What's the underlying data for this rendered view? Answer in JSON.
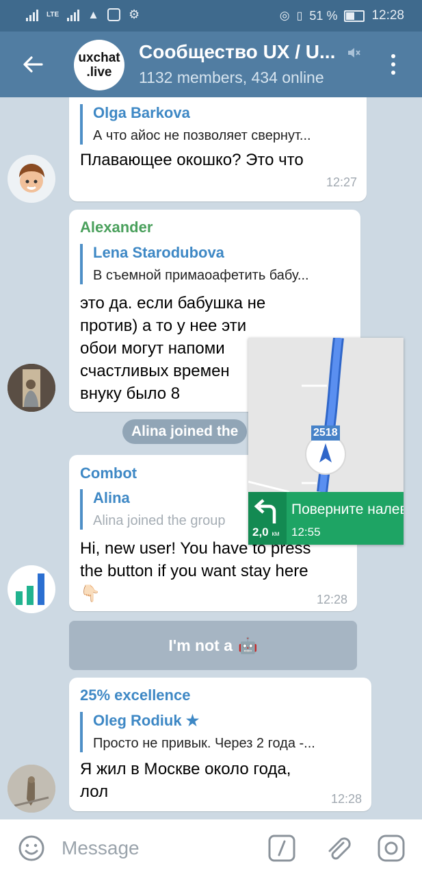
{
  "status_bar": {
    "net": "LTE",
    "battery": "51 %",
    "time": "12:28"
  },
  "header": {
    "avatar_line1": "uxchat",
    "avatar_line2": ".live",
    "title": "Сообщество UX / U...",
    "subtitle": "1132 members, 434 online"
  },
  "messages": [
    {
      "reply_name": "Olga Barkova",
      "reply_text": "А что айос не позволяет свернут...",
      "text": "Плавающее окошко? Это что",
      "time": "12:27"
    },
    {
      "sender": "Alexander",
      "reply_name": "Lena Starodubova",
      "reply_text": "В съемной примаоафетить бабу...",
      "text_lines": [
        "это да. если бабушка не",
        "против) а то у нее эти",
        "обои могут напоми",
        "счастливых времен",
        "внуку было 8"
      ]
    },
    {
      "sender": "Combot",
      "reply_name": "Alina",
      "reply_text": "Alina joined the group",
      "text_lines": [
        "Hi, new user! You have to press",
        "the button if you want stay here",
        "👇🏻"
      ],
      "time": "12:28"
    },
    {
      "sender": "25% excellence",
      "reply_name": "Oleg Rodiuk ★",
      "reply_text": "Просто не привык. Через 2 года -...",
      "text_lines": [
        "Я жил в Москве около года,",
        "лол"
      ],
      "time": "12:28"
    }
  ],
  "service_message": "Alina joined the",
  "inline_button": {
    "label": "I'm not a",
    "emoji": "🤖"
  },
  "navigation_pip": {
    "road_number": "2518",
    "instruction": "Поверните налево",
    "distance": "2,0",
    "distance_unit": "км",
    "eta": "12:55"
  },
  "compose": {
    "placeholder": "Message"
  },
  "colors": {
    "header": "#517da2",
    "status_bar": "#3f6a8d",
    "sender_blue": "#3e88c5",
    "sender_green": "#4aa05c",
    "nav_green": "#1ea464"
  }
}
